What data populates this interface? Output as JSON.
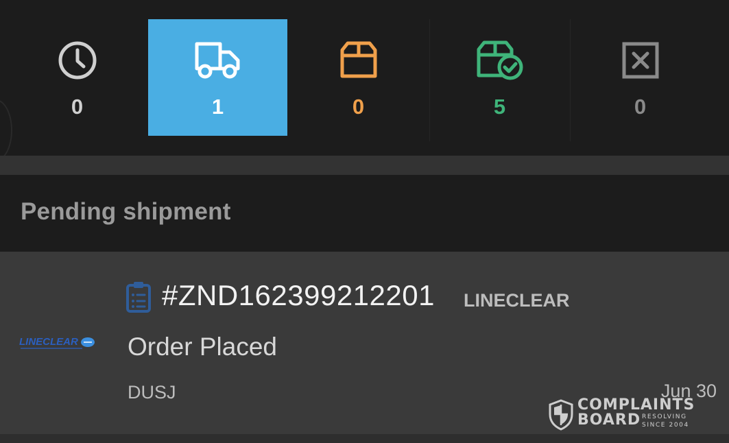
{
  "tabs": [
    {
      "id": "pending",
      "icon": "clock-icon",
      "count": "0",
      "color": "#cfcfcf",
      "active": false
    },
    {
      "id": "shipped",
      "icon": "truck-icon",
      "count": "1",
      "color": "#ffffff",
      "active": true
    },
    {
      "id": "arrived",
      "icon": "box-icon",
      "count": "0",
      "color": "#f0a04b",
      "active": false
    },
    {
      "id": "delivered",
      "icon": "box-check-icon",
      "count": "5",
      "color": "#3fb47a",
      "active": false
    },
    {
      "id": "cancelled",
      "icon": "x-square-icon",
      "count": "0",
      "color": "#8a8a8a",
      "active": false
    }
  ],
  "section": {
    "title": "Pending shipment"
  },
  "order": {
    "carrier_logo": "LINECLEAR",
    "order_id": "#ZND162399212201",
    "carrier": "LINECLEAR",
    "status": "Order Placed",
    "code": "DUSJ",
    "date": "Jun 30"
  },
  "watermark": {
    "line1": "COMPLAINTS",
    "line2": "BOARD",
    "tagline1": "RESOLVING",
    "tagline2": "SINCE 2004"
  },
  "colors": {
    "active_tab": "#4aaee3",
    "background": "#1c1c1c",
    "card": "#3a3a3a"
  }
}
